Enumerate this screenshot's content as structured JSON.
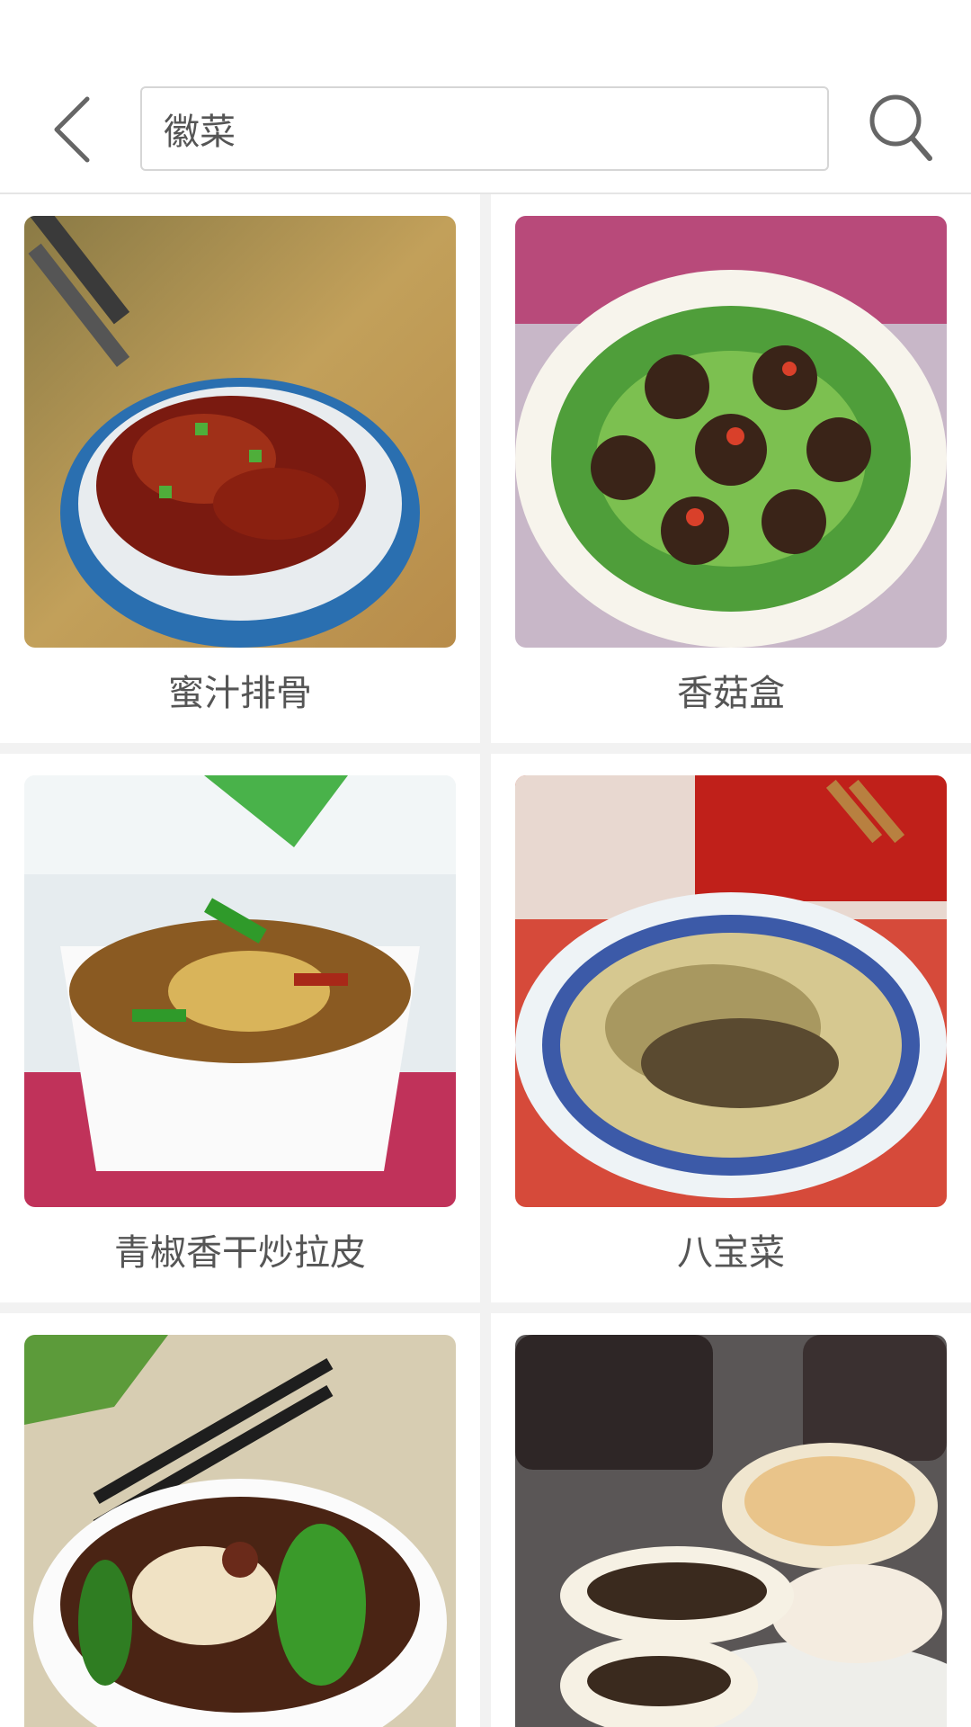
{
  "header": {
    "back_icon": "chevron-left-icon",
    "search_value": "徽菜",
    "search_icon": "search-icon"
  },
  "recipes": [
    {
      "name": "蜜汁排骨"
    },
    {
      "name": "香菇盒"
    },
    {
      "name": "青椒香干炒拉皮"
    },
    {
      "name": "八宝菜"
    },
    {
      "name": ""
    },
    {
      "name": ""
    }
  ],
  "colors": {
    "background": "#f2f2f2",
    "card": "#ffffff",
    "text": "#555555",
    "icon": "#666666",
    "border": "#d6d6d6"
  }
}
